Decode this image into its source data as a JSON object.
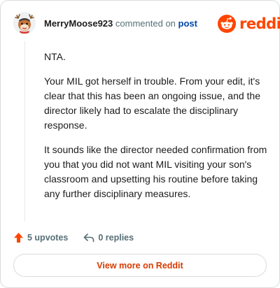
{
  "header": {
    "username": "MerryMoose923",
    "action_text": "commented on",
    "post_link_label": "post",
    "brand_name": "reddit"
  },
  "comment": {
    "paragraphs": [
      "NTA.",
      "Your MIL got herself in trouble. From your edit, it's clear that this has been an ongoing issue, and the director likely had to escalate the disciplinary response.",
      "It sounds like the director needed confirmation from you that you did not want MIL visiting your son's classroom and upsetting his routine before taking any further disciplinary measures."
    ]
  },
  "footer": {
    "upvotes_label": "5 upvotes",
    "replies_label": "0 replies",
    "upvote_icon": "upvote-arrow-icon",
    "reply_icon": "reply-arrow-icon"
  },
  "cta": {
    "view_more_label": "View more on Reddit"
  },
  "colors": {
    "brand": "#ff4500",
    "link": "#0045ac",
    "muted": "#576f76",
    "cta_text": "#d93a00",
    "border": "#d8dbdd"
  }
}
